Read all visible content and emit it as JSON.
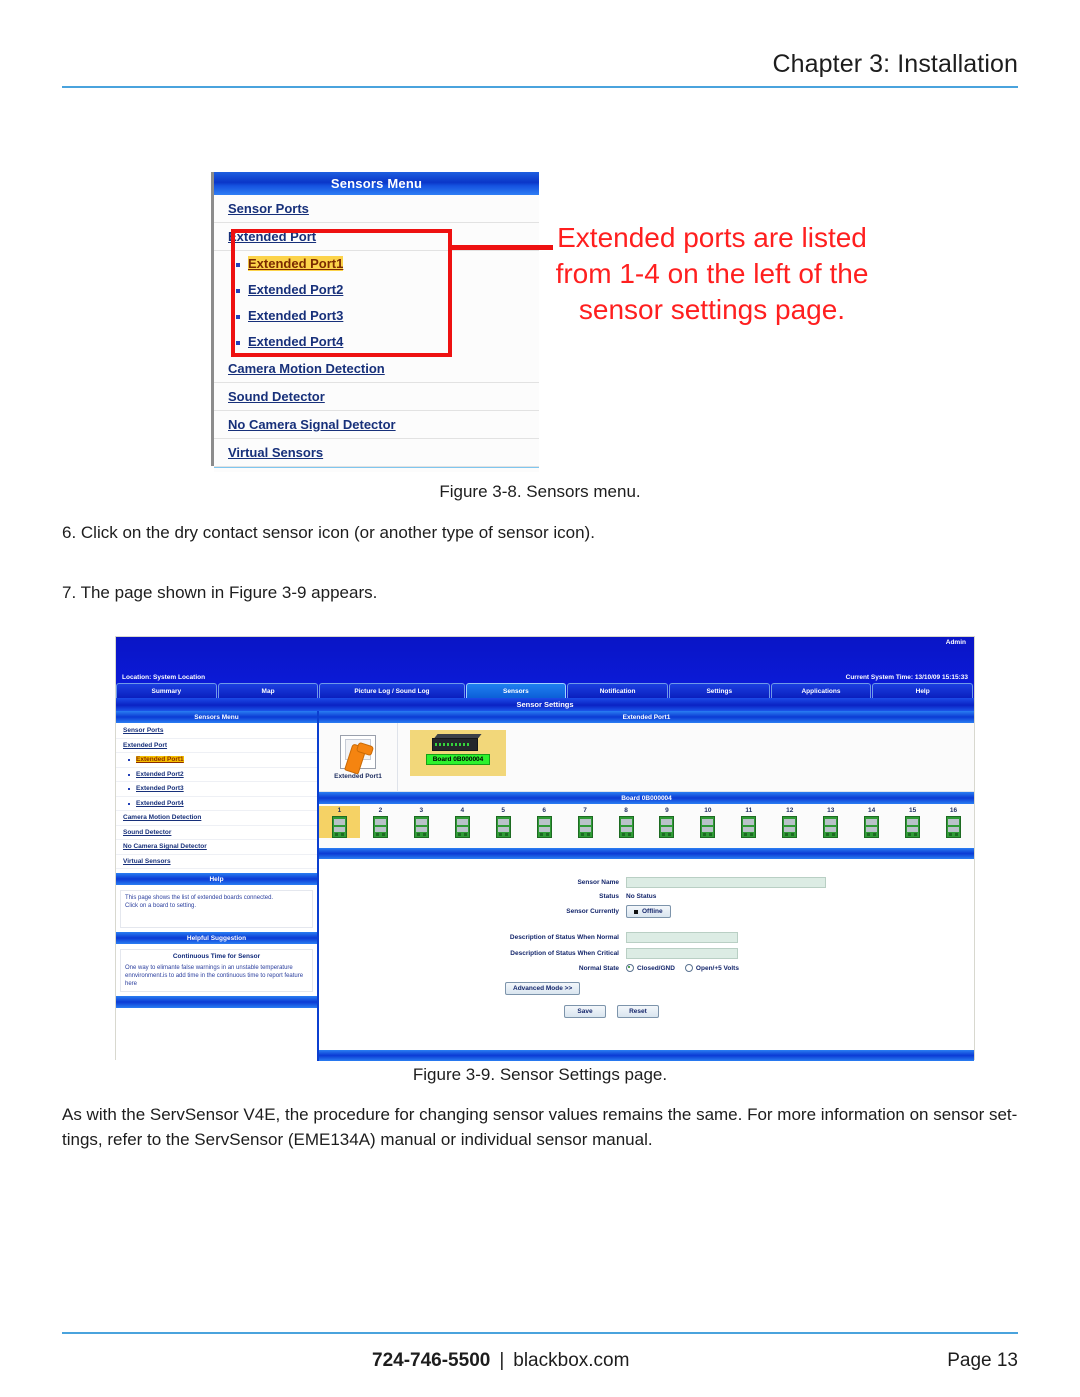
{
  "page": {
    "chapter_title": "Chapter 3: Installation",
    "footer_phone": "724-746-5500",
    "footer_sep": "|",
    "footer_domain": "blackbox.com",
    "footer_page": "Page 13"
  },
  "figure1": {
    "caption": "Figure 3-8. Sensors menu.",
    "menu_title": "Sensors Menu",
    "items": [
      {
        "label": "Sensor Ports",
        "type": "link"
      },
      {
        "label": "Extended Port",
        "type": "link"
      },
      {
        "label": "Extended Port1",
        "type": "sub",
        "selected": true
      },
      {
        "label": "Extended Port2",
        "type": "sub",
        "selected": false
      },
      {
        "label": "Extended Port3",
        "type": "sub",
        "selected": false
      },
      {
        "label": "Extended Port4",
        "type": "sub",
        "selected": false
      },
      {
        "label": "Camera Motion Detection",
        "type": "link"
      },
      {
        "label": "Sound Detector",
        "type": "link"
      },
      {
        "label": "No Camera Signal Detector",
        "type": "link"
      },
      {
        "label": "Virtual Sensors",
        "type": "link"
      }
    ],
    "annotation": {
      "line1": "Extended ports are listed",
      "line2": "from 1-4 on the left of the",
      "line3": "sensor settings page.",
      "color": "#ff1f1f"
    },
    "highlight_color": "#fcd34a",
    "callout_box_color": "#ee1111"
  },
  "body": {
    "step6": "6. Click on the dry contact sensor icon (or another type of sensor icon).",
    "step7": "7. The page shown in Figure 3-9 appears.",
    "closing_line1": "As with the ServSensor V4E, the procedure for changing sensor values remains the same. For more information on sensor set-",
    "closing_line2": "tings, refer to the ServSensor (EME134A) manual or individual sensor manual."
  },
  "figure2": {
    "caption": "Figure 3-9. Sensor Settings page.",
    "header": {
      "admin": "Admin",
      "location": "Location: System Location",
      "system_time": "Current System Time: 13/10/09 15:15:33"
    },
    "tabs": [
      {
        "label": "Summary",
        "active": false,
        "wide": false
      },
      {
        "label": "Map",
        "active": false,
        "wide": false
      },
      {
        "label": "Picture Log / Sound Log",
        "active": false,
        "wide": true
      },
      {
        "label": "Sensors",
        "active": true,
        "wide": false
      },
      {
        "label": "Notification",
        "active": false,
        "wide": false
      },
      {
        "label": "Settings",
        "active": false,
        "wide": false
      },
      {
        "label": "Applications",
        "active": false,
        "wide": false
      },
      {
        "label": "Help",
        "active": false,
        "wide": false
      }
    ],
    "page_title": "Sensor Settings",
    "sidebar": {
      "menu_title": "Sensors Menu",
      "items": [
        {
          "label": "Sensor Ports",
          "type": "link"
        },
        {
          "label": "Extended Port",
          "type": "link"
        },
        {
          "label": "Extended Port1",
          "type": "sub",
          "selected": true
        },
        {
          "label": "Extended Port2",
          "type": "sub",
          "selected": false
        },
        {
          "label": "Extended Port3",
          "type": "sub",
          "selected": false
        },
        {
          "label": "Extended Port4",
          "type": "sub",
          "selected": false
        },
        {
          "label": "Camera Motion Detection",
          "type": "link"
        },
        {
          "label": "Sound Detector",
          "type": "link"
        },
        {
          "label": "No Camera Signal Detector",
          "type": "link"
        },
        {
          "label": "Virtual Sensors",
          "type": "link"
        }
      ],
      "help_title": "Help",
      "help_line1": "This page shows the list of extended boards connected.",
      "help_line2": "Click on a board to setting.",
      "suggestion_title": "Helpful Suggestion",
      "suggestion_subtitle": "Continuous Time for Sensor",
      "suggestion_text": "One way to elimante false warnings in an unstable temperature ennvironment.is to add time in the continuous time to report feature here"
    },
    "content": {
      "section_title": "Extended Port1",
      "port_icon_label": "Extended Port1",
      "board_tag": "Board 0B000004",
      "board_section_title": "Board 0B000004",
      "ports": [
        "1",
        "2",
        "3",
        "4",
        "5",
        "6",
        "7",
        "8",
        "9",
        "10",
        "11",
        "12",
        "13",
        "14",
        "15",
        "16"
      ],
      "selected_port": "1",
      "form": {
        "sensor_name_label": "Sensor Name",
        "sensor_name_value": "",
        "status_label": "Status",
        "status_value": "No Status",
        "sensor_currently_label": "Sensor Currently",
        "sensor_currently_value": "Offline",
        "desc_normal_label": "Description of Status When Normal",
        "desc_normal_value": "",
        "desc_critical_label": "Description of Status When Critical",
        "desc_critical_value": "",
        "normal_state_label": "Normal State",
        "normal_state_options": [
          {
            "label": "Closed/GND",
            "selected": true
          },
          {
            "label": "Open/+5 Volts",
            "selected": false
          }
        ],
        "advanced_mode_label": "Advanced Mode >>",
        "save_label": "Save",
        "reset_label": "Reset"
      }
    }
  }
}
